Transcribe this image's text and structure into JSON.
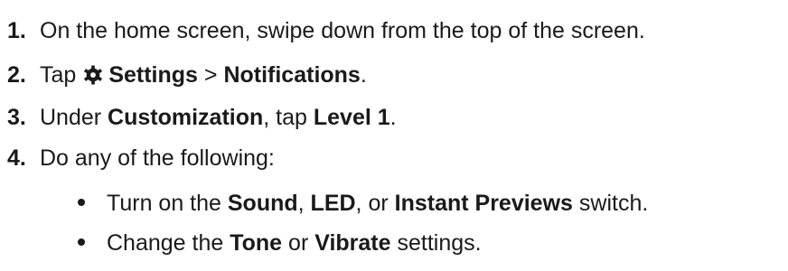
{
  "steps": [
    {
      "number": "1.",
      "text": "On the home screen, swipe down from the top of the screen."
    },
    {
      "number": "2.",
      "prefix": "Tap",
      "icon": "gear-icon",
      "settings": "Settings",
      "separator": " > ",
      "notifications": "Notifications",
      "end": "."
    },
    {
      "number": "3.",
      "prefix": "Under ",
      "customization": "Customization",
      "middle": ", tap ",
      "level": "Level 1",
      "end": "."
    },
    {
      "number": "4.",
      "text": "Do any of the following:"
    }
  ],
  "bullets": [
    {
      "prefix": "Turn on the ",
      "sound": "Sound",
      "comma1": ", ",
      "led": "LED",
      "or": ", or ",
      "instant": "Instant Previews",
      "end": " switch."
    },
    {
      "prefix": "Change the ",
      "tone": "Tone",
      "or": " or ",
      "vibrate": "Vibrate",
      "end": " settings."
    }
  ]
}
